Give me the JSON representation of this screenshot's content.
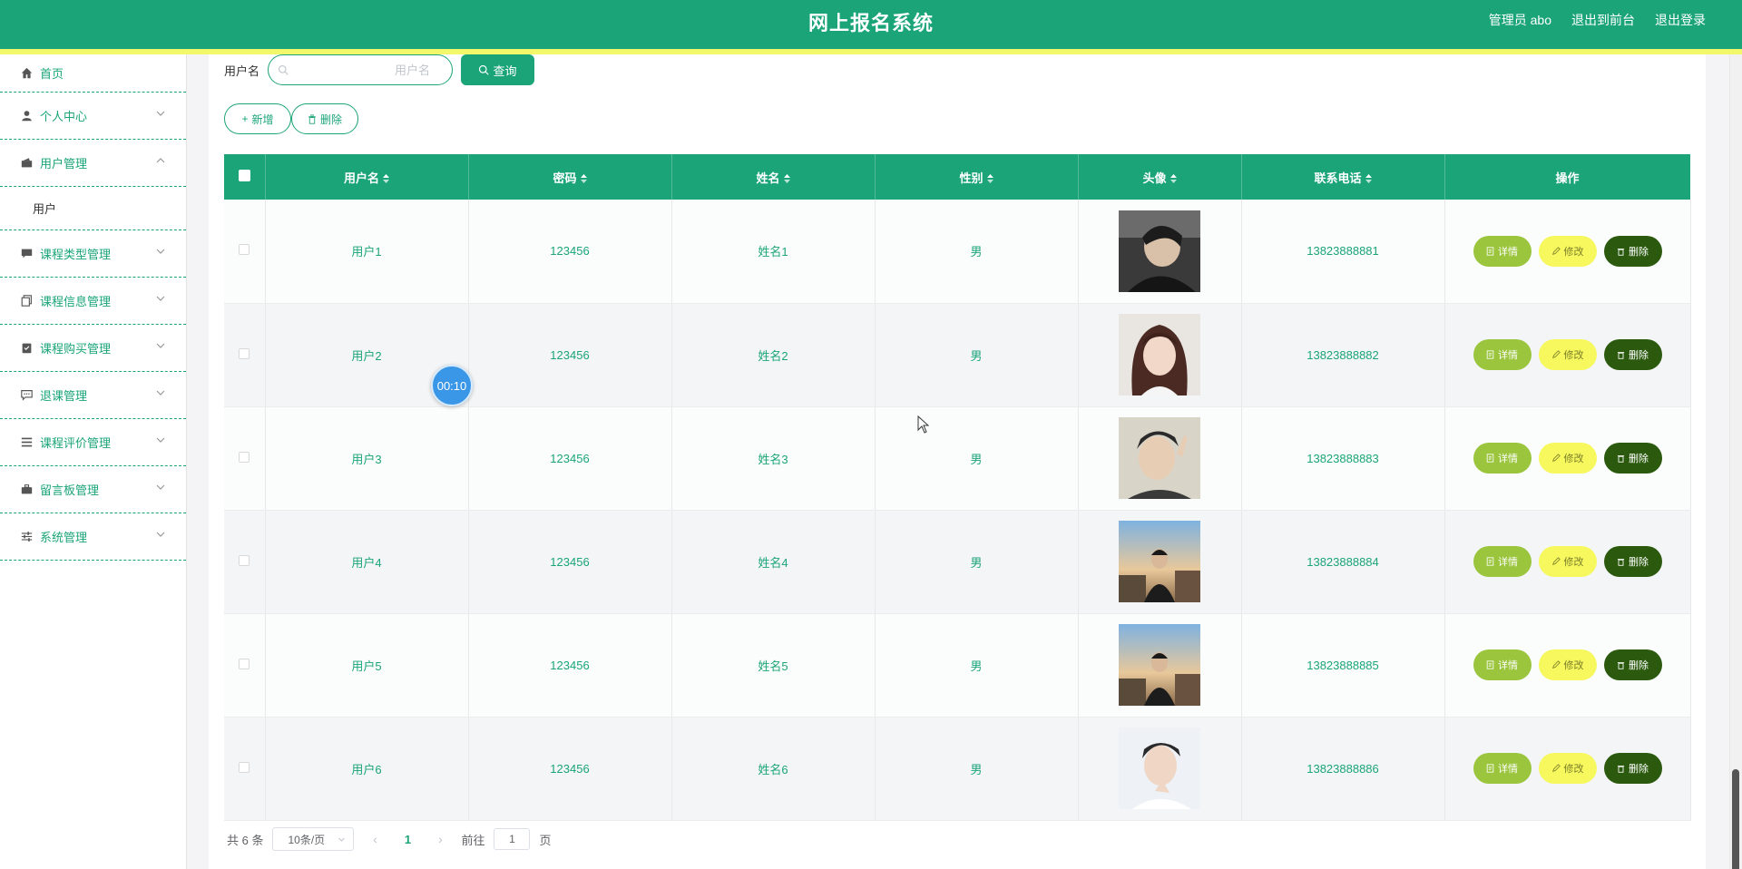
{
  "header": {
    "title": "网上报名系统",
    "admin_label": "管理员 abo",
    "to_front": "退出到前台",
    "logout": "退出登录"
  },
  "sidebar": {
    "items": [
      {
        "label": "首页",
        "icon": "home-icon"
      },
      {
        "label": "个人中心",
        "icon": "user-icon"
      },
      {
        "label": "用户管理",
        "icon": "wallet-icon",
        "expanded": true,
        "children": [
          {
            "label": "用户"
          }
        ]
      },
      {
        "label": "课程类型管理",
        "icon": "chat-icon"
      },
      {
        "label": "课程信息管理",
        "icon": "copy-icon"
      },
      {
        "label": "课程购买管理",
        "icon": "clipboard-icon"
      },
      {
        "label": "退课管理",
        "icon": "message-icon"
      },
      {
        "label": "课程评价管理",
        "icon": "list-icon"
      },
      {
        "label": "留言板管理",
        "icon": "briefcase-icon"
      },
      {
        "label": "系统管理",
        "icon": "sliders-icon"
      }
    ]
  },
  "search": {
    "label": "用户名",
    "placeholder": "用户名",
    "value": "",
    "button_label": "查询"
  },
  "toolbar": {
    "add_label": "新增",
    "delete_label": "删除"
  },
  "table": {
    "headers": [
      "用户名",
      "密码",
      "姓名",
      "性别",
      "头像",
      "联系电话",
      "操作"
    ],
    "rows": [
      {
        "username": "用户1",
        "password": "123456",
        "name": "姓名1",
        "gender": "男",
        "phone": "13823888881"
      },
      {
        "username": "用户2",
        "password": "123456",
        "name": "姓名2",
        "gender": "男",
        "phone": "13823888882"
      },
      {
        "username": "用户3",
        "password": "123456",
        "name": "姓名3",
        "gender": "男",
        "phone": "13823888883"
      },
      {
        "username": "用户4",
        "password": "123456",
        "name": "姓名4",
        "gender": "男",
        "phone": "13823888884"
      },
      {
        "username": "用户5",
        "password": "123456",
        "name": "姓名5",
        "gender": "男",
        "phone": "13823888885"
      },
      {
        "username": "用户6",
        "password": "123456",
        "name": "姓名6",
        "gender": "男",
        "phone": "13823888886"
      }
    ],
    "actions": {
      "detail": "详情",
      "edit": "修改",
      "delete": "删除"
    }
  },
  "pagination": {
    "total": "共 6 条",
    "page_size": "10条/页",
    "current_page": "1",
    "goto_prefix": "前往",
    "goto_value": "1",
    "goto_suffix": "页"
  },
  "overlay": {
    "timer": "00:10"
  },
  "colors": {
    "primary": "#1aa478",
    "stripe": "#f3f86a",
    "detail": "#9bc53d",
    "edit": "#f6f85e",
    "delete": "#2b5a0e"
  }
}
